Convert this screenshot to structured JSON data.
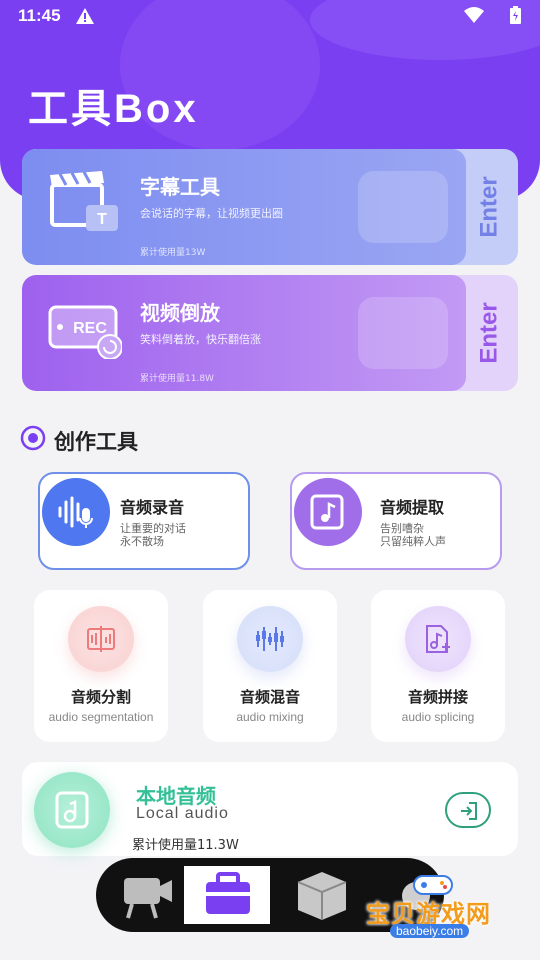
{
  "status_bar": {
    "time": "11:45"
  },
  "app": {
    "title": "工具Box"
  },
  "feature_cards": [
    {
      "title": "字幕工具",
      "desc": "会说话的字幕，让视频更出圈",
      "usage": "累计使用量13W",
      "enter": "Enter"
    },
    {
      "title": "视频倒放",
      "desc": "笑料倒着放，快乐翻倍涨",
      "usage": "累计使用量11.8W",
      "enter": "Enter",
      "icon_text": "REC"
    }
  ],
  "section": {
    "title": "创作工具"
  },
  "big_tools": [
    {
      "title": "音频录音",
      "desc": "让重要的对话\n永不散场"
    },
    {
      "title": "音频提取",
      "desc": "告别嘈杂\n只留纯粹人声"
    }
  ],
  "small_tools": [
    {
      "title": "音频分割",
      "sub": "audio segmentation"
    },
    {
      "title": "音频混音",
      "sub": "audio mixing"
    },
    {
      "title": "音频拼接",
      "sub": "audio splicing"
    }
  ],
  "local_audio": {
    "title": "本地音频",
    "sub": "Local audio",
    "usage": "累计使用量11.3W"
  },
  "watermark": {
    "text": "宝贝游戏网",
    "url": "baobeiy.com"
  },
  "colors": {
    "header_purple": "#7b3ff2",
    "subtitle_card": "#7d8df0",
    "reverse_card": "#9e61ee",
    "record_blue": "#4f77f0",
    "extract_purple": "#a06ee8",
    "local_green": "#33c097"
  },
  "icons": [
    "warning-icon",
    "wifi-icon",
    "battery-icon",
    "clapperboard-icon",
    "rec-icon",
    "target-icon",
    "voice-wave-icon",
    "music-file-icon",
    "split-icon",
    "mixer-icon",
    "splice-icon",
    "local-file-icon",
    "enter-arrow-icon",
    "video-camera-icon",
    "toolbox-icon",
    "cube-icon"
  ]
}
